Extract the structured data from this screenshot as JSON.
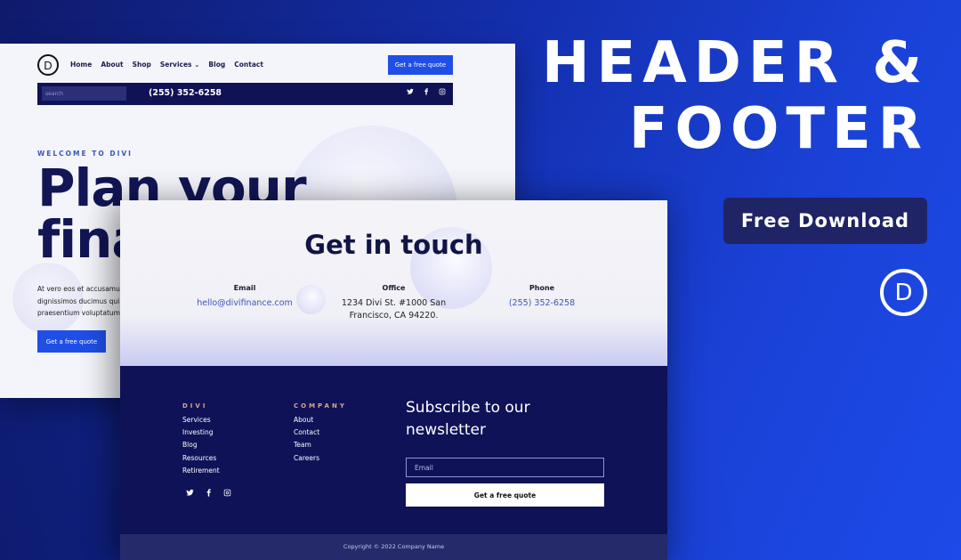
{
  "header_mockup": {
    "logo_letter": "D",
    "nav": [
      "Home",
      "About",
      "Shop",
      "Services ⌄",
      "Blog",
      "Contact"
    ],
    "quote_button": "Get a free quote",
    "search_placeholder": "search",
    "phone": "(255) 352-6258",
    "social_icons": [
      "twitter-icon",
      "facebook-icon",
      "instagram-icon"
    ],
    "welcome": "WELCOME TO DIVI",
    "headline_line1": "Plan your",
    "headline_line2": "finances",
    "body_lines": [
      "At vero eos et accusamus et iusto odio",
      "dignissimos ducimus qui blanditiis",
      "praesentium voluptatum."
    ],
    "cta_button": "Get a free quote"
  },
  "footer_mockup": {
    "contact_title": "Get in touch",
    "email_label": "Email",
    "email_value": "hello@divifinance.com",
    "office_label": "Office",
    "office_value": "1234 Divi St. #1000 San Francisco, CA 94220.",
    "phone_label": "Phone",
    "phone_value": "(255) 352-6258",
    "col1_heading": "DIVI",
    "col1_links": [
      "Services",
      "Investing",
      "Blog",
      "Resources",
      "Retirement"
    ],
    "col2_heading": "COMPANY",
    "col2_links": [
      "About",
      "Contact",
      "Team",
      "Careers"
    ],
    "newsletter_title": "Subscribe to our newsletter",
    "email_placeholder": "Email",
    "submit_button": "Get a free quote",
    "copyright": "Copyright © 2022 Company Name"
  },
  "promo": {
    "title_line1": "HEADER &",
    "title_line2": "FOOTER",
    "download_button": "Free Download",
    "logo_letter": "D"
  },
  "colors": {
    "accent_blue": "#1f4fe6",
    "navy": "#0f1257",
    "heading_accent": "#d7a68a"
  }
}
